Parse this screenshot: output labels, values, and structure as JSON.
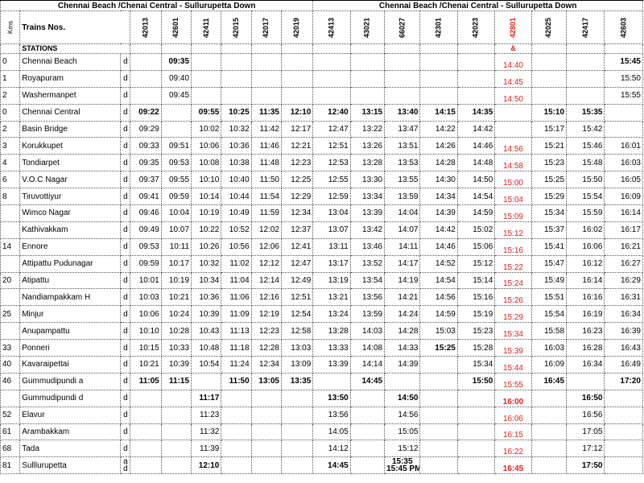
{
  "title_left": "Chennai Beach /Chenai Central - Sullurupetta    Down",
  "title_right": "Chennai Beach /Chenai Central - Sullurupetta    Down",
  "kms_label": "Kms",
  "trains_label": "Trains Nos.",
  "stations_label": "STATIONS",
  "trains": [
    "42013",
    "42601",
    "42411",
    "42015",
    "42017",
    "42019",
    "42413",
    "43021",
    "66027",
    "42301",
    "42023",
    "42801",
    "42025",
    "42417",
    "42603"
  ],
  "red_train_marker": "&",
  "rows": [
    {
      "km": "0",
      "station": "Chennai Beach",
      "ad": "d",
      "times": [
        "",
        "09:35",
        "",
        "",
        "",
        "",
        "",
        "",
        "",
        "",
        "",
        "14:40",
        "",
        "",
        "15:45"
      ],
      "bold": [
        1,
        14
      ]
    },
    {
      "km": "1",
      "station": "Royapuram",
      "ad": "d",
      "times": [
        "",
        "09:40",
        "",
        "",
        "",
        "",
        "",
        "",
        "",
        "",
        "",
        "14:45",
        "",
        "",
        "15:50"
      ],
      "bold": []
    },
    {
      "km": "2",
      "station": "Washermanpet",
      "ad": "d",
      "times": [
        "",
        "09:45",
        "",
        "",
        "",
        "",
        "",
        "",
        "",
        "",
        "",
        "14:50",
        "",
        "",
        "15:55"
      ],
      "bold": []
    },
    {
      "km": "0",
      "station": "Chennai Central",
      "ad": "d",
      "times": [
        "09:22",
        "",
        "09:55",
        "10:25",
        "11:35",
        "12:10",
        "12:40",
        "13:15",
        "13:40",
        "14:15",
        "14:35",
        "",
        "15:10",
        "15:35",
        ""
      ],
      "bold": [
        0,
        2,
        3,
        4,
        5,
        6,
        7,
        8,
        9,
        10,
        12,
        13
      ]
    },
    {
      "km": "2",
      "station": "Basin Bridge",
      "ad": "d",
      "times": [
        "09:29",
        "",
        "10:02",
        "10:32",
        "11:42",
        "12:17",
        "12:47",
        "13:22",
        "13:47",
        "14:22",
        "14:42",
        "",
        "15:17",
        "15:42",
        ""
      ],
      "bold": []
    },
    {
      "km": "3",
      "station": "Korukkupet",
      "ad": "d",
      "times": [
        "09:33",
        "09:51",
        "10:06",
        "10:36",
        "11:46",
        "12:21",
        "12:51",
        "13:26",
        "13:51",
        "14:26",
        "14:46",
        "14:56",
        "15:21",
        "15:46",
        "16:01"
      ],
      "bold": []
    },
    {
      "km": "4",
      "station": "Tondiarpet",
      "ad": "d",
      "times": [
        "09:35",
        "09:53",
        "10:08",
        "10:38",
        "11:48",
        "12:23",
        "12:53",
        "13:28",
        "13:53",
        "14:28",
        "14:48",
        "14:58",
        "15:23",
        "15:48",
        "16:03"
      ],
      "bold": []
    },
    {
      "km": "6",
      "station": "V.O.C Nagar",
      "ad": "d",
      "times": [
        "09:37",
        "09:55",
        "10:10",
        "10:40",
        "11:50",
        "12:25",
        "12:55",
        "13:30",
        "13:55",
        "14:30",
        "14:50",
        "15:00",
        "15:25",
        "15:50",
        "16:05"
      ],
      "bold": []
    },
    {
      "km": "8",
      "station": "Tiruvottiyur",
      "ad": "d",
      "times": [
        "09:41",
        "09:59",
        "10:14",
        "10:44",
        "11:54",
        "12:29",
        "12:59",
        "13:34",
        "13:59",
        "14:34",
        "14:54",
        "15:04",
        "15:29",
        "15:54",
        "16:09"
      ],
      "bold": []
    },
    {
      "km": "",
      "station": "Wimco Nagar",
      "ad": "d",
      "times": [
        "09:46",
        "10:04",
        "10:19",
        "10:49",
        "11:59",
        "12:34",
        "13:04",
        "13:39",
        "14:04",
        "14:39",
        "14:59",
        "15:09",
        "15:34",
        "15:59",
        "16:14"
      ],
      "bold": []
    },
    {
      "km": "",
      "station": "Kathivakkam",
      "ad": "d",
      "times": [
        "09:49",
        "10:07",
        "10:22",
        "10:52",
        "12:02",
        "12:37",
        "13:07",
        "13:42",
        "14:07",
        "14:42",
        "15:02",
        "15:12",
        "15:37",
        "16:02",
        "16:17"
      ],
      "bold": []
    },
    {
      "km": "14",
      "station": "Ennore",
      "ad": "d",
      "times": [
        "09:53",
        "10:11",
        "10:26",
        "10:56",
        "12:06",
        "12:41",
        "13:11",
        "13:46",
        "14:11",
        "14:46",
        "15:06",
        "15:16",
        "15:41",
        "16:06",
        "16:21"
      ],
      "bold": []
    },
    {
      "km": "",
      "station": "Attipattu Pudunagar",
      "ad": "d",
      "times": [
        "09:59",
        "10:17",
        "10:32",
        "11:02",
        "12:12",
        "12:47",
        "13:17",
        "13:52",
        "14:17",
        "14:52",
        "15:12",
        "15:22",
        "15:47",
        "16:12",
        "16:27"
      ],
      "bold": []
    },
    {
      "km": "20",
      "station": "Atipattu",
      "ad": "d",
      "times": [
        "10:01",
        "10:19",
        "10:34",
        "11:04",
        "12:14",
        "12:49",
        "13:19",
        "13:54",
        "14:19",
        "14:54",
        "15:14",
        "15:24",
        "15:49",
        "16:14",
        "16:29"
      ],
      "bold": []
    },
    {
      "km": "",
      "station": "Nandiampakkam H",
      "ad": "d",
      "times": [
        "10:03",
        "10:21",
        "10:36",
        "11:06",
        "12:16",
        "12:51",
        "13:21",
        "13:56",
        "14:21",
        "14:56",
        "15:16",
        "15:26",
        "15:51",
        "16:16",
        "16:31"
      ],
      "bold": []
    },
    {
      "km": "25",
      "station": "Minjur",
      "ad": "d",
      "times": [
        "10:06",
        "10:24",
        "10:39",
        "11:09",
        "12:19",
        "12:54",
        "13:24",
        "13:59",
        "14:24",
        "14:59",
        "15:19",
        "15:29",
        "15:54",
        "16:19",
        "16:34"
      ],
      "bold": []
    },
    {
      "km": "",
      "station": "Anupampattu",
      "ad": "d",
      "times": [
        "10:10",
        "10:28",
        "10:43",
        "11:13",
        "12:23",
        "12:58",
        "13:28",
        "14:03",
        "14:28",
        "15:03",
        "15:23",
        "15:34",
        "15:58",
        "16:23",
        "16:39"
      ],
      "bold": []
    },
    {
      "km": "33",
      "station": "Ponneri",
      "ad": "d",
      "times": [
        "10:15",
        "10:33",
        "10:48",
        "11:18",
        "12:28",
        "13:03",
        "13:33",
        "14:08",
        "14:33",
        "15:25",
        "15:28",
        "15:39",
        "16:03",
        "16:28",
        "16:43"
      ],
      "bold": [
        9
      ]
    },
    {
      "km": "40",
      "station": "Kavaraipettai",
      "ad": "d",
      "times": [
        "10:21",
        "10:39",
        "10:54",
        "11:24",
        "12:34",
        "13:09",
        "13:39",
        "14:14",
        "14:39",
        "",
        "15:34",
        "15:44",
        "16:09",
        "16:34",
        "16:49"
      ],
      "bold": []
    },
    {
      "km": "46",
      "station": "Gummudipundi   a",
      "ad": "d",
      "times": [
        "11:05",
        "11:15",
        "",
        "11:50",
        "13:05",
        "13:35",
        "",
        "14:45",
        "",
        "",
        "15:50",
        "15:55",
        "16:45",
        "",
        "17:20"
      ],
      "bold": [
        0,
        1,
        3,
        4,
        5,
        7,
        10,
        12,
        14
      ]
    },
    {
      "km": "",
      "station": "Gummudipundi   d",
      "ad": "d",
      "times": [
        "",
        "",
        "11:17",
        "",
        "",
        "",
        "13:50",
        "",
        "14:50",
        "",
        "",
        "16:00",
        "",
        "16:50",
        ""
      ],
      "bold": [
        2,
        6,
        8,
        11,
        13
      ]
    },
    {
      "km": "52",
      "station": "Elavur",
      "ad": "d",
      "times": [
        "",
        "",
        "11:23",
        "",
        "",
        "",
        "13:56",
        "",
        "14:56",
        "",
        "",
        "16:06",
        "",
        "16:56",
        ""
      ],
      "bold": []
    },
    {
      "km": "61",
      "station": "Arambakkam",
      "ad": "d",
      "times": [
        "",
        "",
        "11:32",
        "",
        "",
        "",
        "14:05",
        "",
        "15:05",
        "",
        "",
        "16:15",
        "",
        "17:05",
        ""
      ],
      "bold": []
    },
    {
      "km": "68",
      "station": "Tada",
      "ad": "d",
      "times": [
        "",
        "",
        "11:39",
        "",
        "",
        "",
        "14:12",
        "",
        "15:12",
        "",
        "",
        "16:22",
        "",
        "17:12",
        ""
      ],
      "bold": []
    },
    {
      "km": "81",
      "station": "Sulllurupetta",
      "ad": "a\nd",
      "times": [
        "",
        "",
        "12:10",
        "",
        "",
        "",
        "14:45",
        "",
        "15:35",
        "",
        "",
        "16:45",
        "",
        "17:50",
        ""
      ],
      "bold": [
        2,
        6,
        11,
        13
      ]
    }
  ],
  "last_row_extra": "15:45 PM"
}
